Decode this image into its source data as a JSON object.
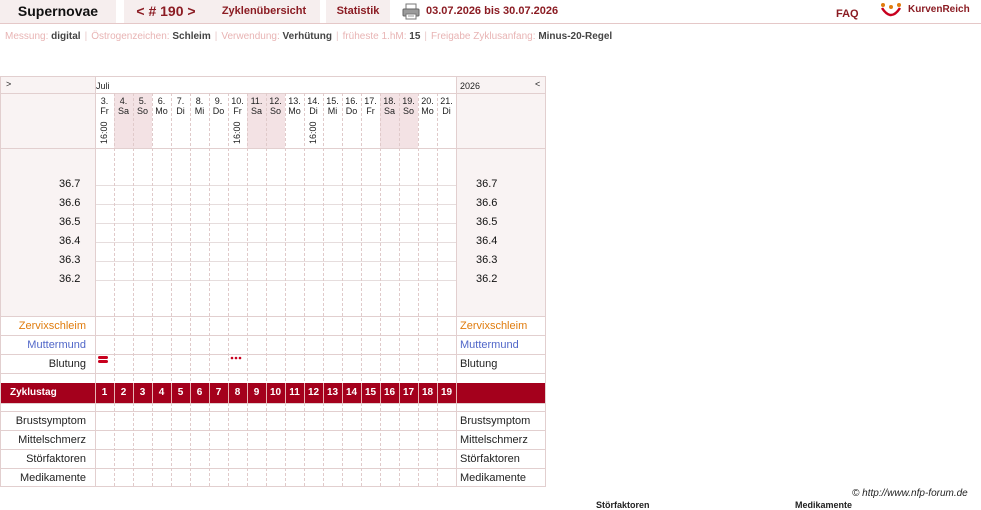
{
  "header": {
    "brand": "Supernovae",
    "cycle_number": "< # 190 >",
    "overview_label": "Zyklenübersicht",
    "stats_label": "Statistik",
    "date_range": "03.07.2026 bis 30.07.2026",
    "faq_label": "FAQ",
    "logo_text": "KurvenReich"
  },
  "info": [
    {
      "label": "Messung:",
      "value": "digital"
    },
    {
      "label": "Östrogenzeichen:",
      "value": "Schleim"
    },
    {
      "label": "Verwendung:",
      "value": "Verhütung"
    },
    {
      "label": "früheste 1.hM:",
      "value": "15"
    },
    {
      "label": "Freigabe Zyklusanfang:",
      "value": "Minus-20-Regel"
    }
  ],
  "chart": {
    "nav_prev": ">",
    "nav_next": "<",
    "month": "Juli",
    "year": "2026",
    "days": [
      {
        "date": "3.",
        "weekday": "Fr",
        "weekend": false
      },
      {
        "date": "4.",
        "weekday": "Sa",
        "weekend": true
      },
      {
        "date": "5.",
        "weekday": "So",
        "weekend": true
      },
      {
        "date": "6.",
        "weekday": "Mo",
        "weekend": false
      },
      {
        "date": "7.",
        "weekday": "Di",
        "weekend": false
      },
      {
        "date": "8.",
        "weekday": "Mi",
        "weekend": false
      },
      {
        "date": "9.",
        "weekday": "Do",
        "weekend": false
      },
      {
        "date": "10.",
        "weekday": "Fr",
        "weekend": false
      },
      {
        "date": "11.",
        "weekday": "Sa",
        "weekend": true
      },
      {
        "date": "12.",
        "weekday": "So",
        "weekend": true
      },
      {
        "date": "13.",
        "weekday": "Mo",
        "weekend": false
      },
      {
        "date": "14.",
        "weekday": "Di",
        "weekend": false
      },
      {
        "date": "15.",
        "weekday": "Mi",
        "weekend": false
      },
      {
        "date": "16.",
        "weekday": "Do",
        "weekend": false
      },
      {
        "date": "17.",
        "weekday": "Fr",
        "weekend": false
      },
      {
        "date": "18.",
        "weekday": "Sa",
        "weekend": true
      },
      {
        "date": "19.",
        "weekday": "So",
        "weekend": true
      },
      {
        "date": "20.",
        "weekday": "Mo",
        "weekend": false
      },
      {
        "date": "21.",
        "weekday": "Di",
        "weekend": false
      }
    ],
    "times": [
      {
        "day_index": 0,
        "time": "16:00"
      },
      {
        "day_index": 7,
        "time": "16:00"
      },
      {
        "day_index": 11,
        "time": "16:00"
      }
    ],
    "temp_ticks": [
      "36.7",
      "36.6",
      "36.5",
      "36.4",
      "36.3",
      "36.2"
    ],
    "rows": {
      "cervical_mucus": "Zervixschleim",
      "cervix": "Muttermund",
      "bleeding": "Blutung",
      "cycle_day": "Zyklustag",
      "breast": "Brustsymptom",
      "mittelschmerz": "Mittelschmerz",
      "disturbances": "Störfaktoren",
      "medication": "Medikamente"
    },
    "bleeding": [
      {
        "day_index": 0,
        "level": "strong"
      },
      {
        "day_index": 7,
        "level": "spotting"
      }
    ],
    "cycle_days": [
      "1",
      "2",
      "3",
      "4",
      "5",
      "6",
      "7",
      "8",
      "9",
      "10",
      "11",
      "12",
      "13",
      "14",
      "15",
      "16",
      "17",
      "18",
      "19"
    ]
  },
  "footer": {
    "copyright": "© http://www.nfp-forum.de",
    "cut_label_1": "Störfaktoren",
    "cut_label_2": "Medikamente"
  },
  "colors": {
    "accent": "#8b1c23",
    "zyklus_bar": "#a4001c",
    "bleeding": "#c8001e",
    "mucus_label": "#e07c0e",
    "cervix_label": "#5066c8"
  }
}
